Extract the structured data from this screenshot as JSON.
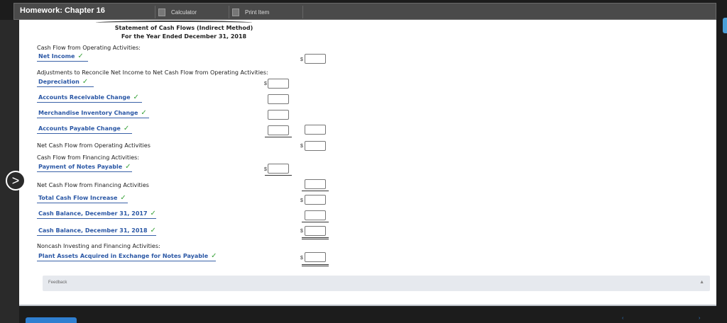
{
  "header": {
    "title": "Homework: Chapter 16",
    "calculator_label": "Calculator",
    "print_label": "Print Item"
  },
  "statement": {
    "title": "Statement of Cash Flows (Indirect Method)",
    "period": "For the Year Ended December 31, 2018"
  },
  "labels": {
    "operating": "Cash Flow from Operating Activities:",
    "adjustments": "Adjustments to Reconcile Net Income to Net Cash Flow from Operating Activities:",
    "net_operating": "Net Cash Flow from Operating Activities",
    "financing": "Cash Flow from Financing Activities:",
    "net_financing": "Net Cash Flow from Financing Activities",
    "noncash": "Noncash Investing and Financing Activities:"
  },
  "selections": {
    "net_income": "Net Income",
    "depreciation": "Depreciation",
    "accounts_receivable": "Accounts Receivable Change",
    "merchandise_inventory": "Merchandise Inventory Change",
    "accounts_payable": "Accounts Payable Change",
    "payment_notes": "Payment of Notes Payable",
    "total_cash_flow": "Total Cash Flow Increase",
    "cash_2017": "Cash Balance, December 31, 2017",
    "cash_2018": "Cash Balance, December 31, 2018",
    "plant_assets": "Plant Assets Acquired in Exchange for Notes Payable"
  },
  "check_mark": "✓",
  "currency_symbol": "$",
  "feedback_label": "Feedback",
  "feedback_arrow": "▲",
  "nav_label": ">",
  "colors": {
    "accent": "#2a57a5",
    "check": "#3aa33a",
    "topbar": "#4a4a4a"
  }
}
